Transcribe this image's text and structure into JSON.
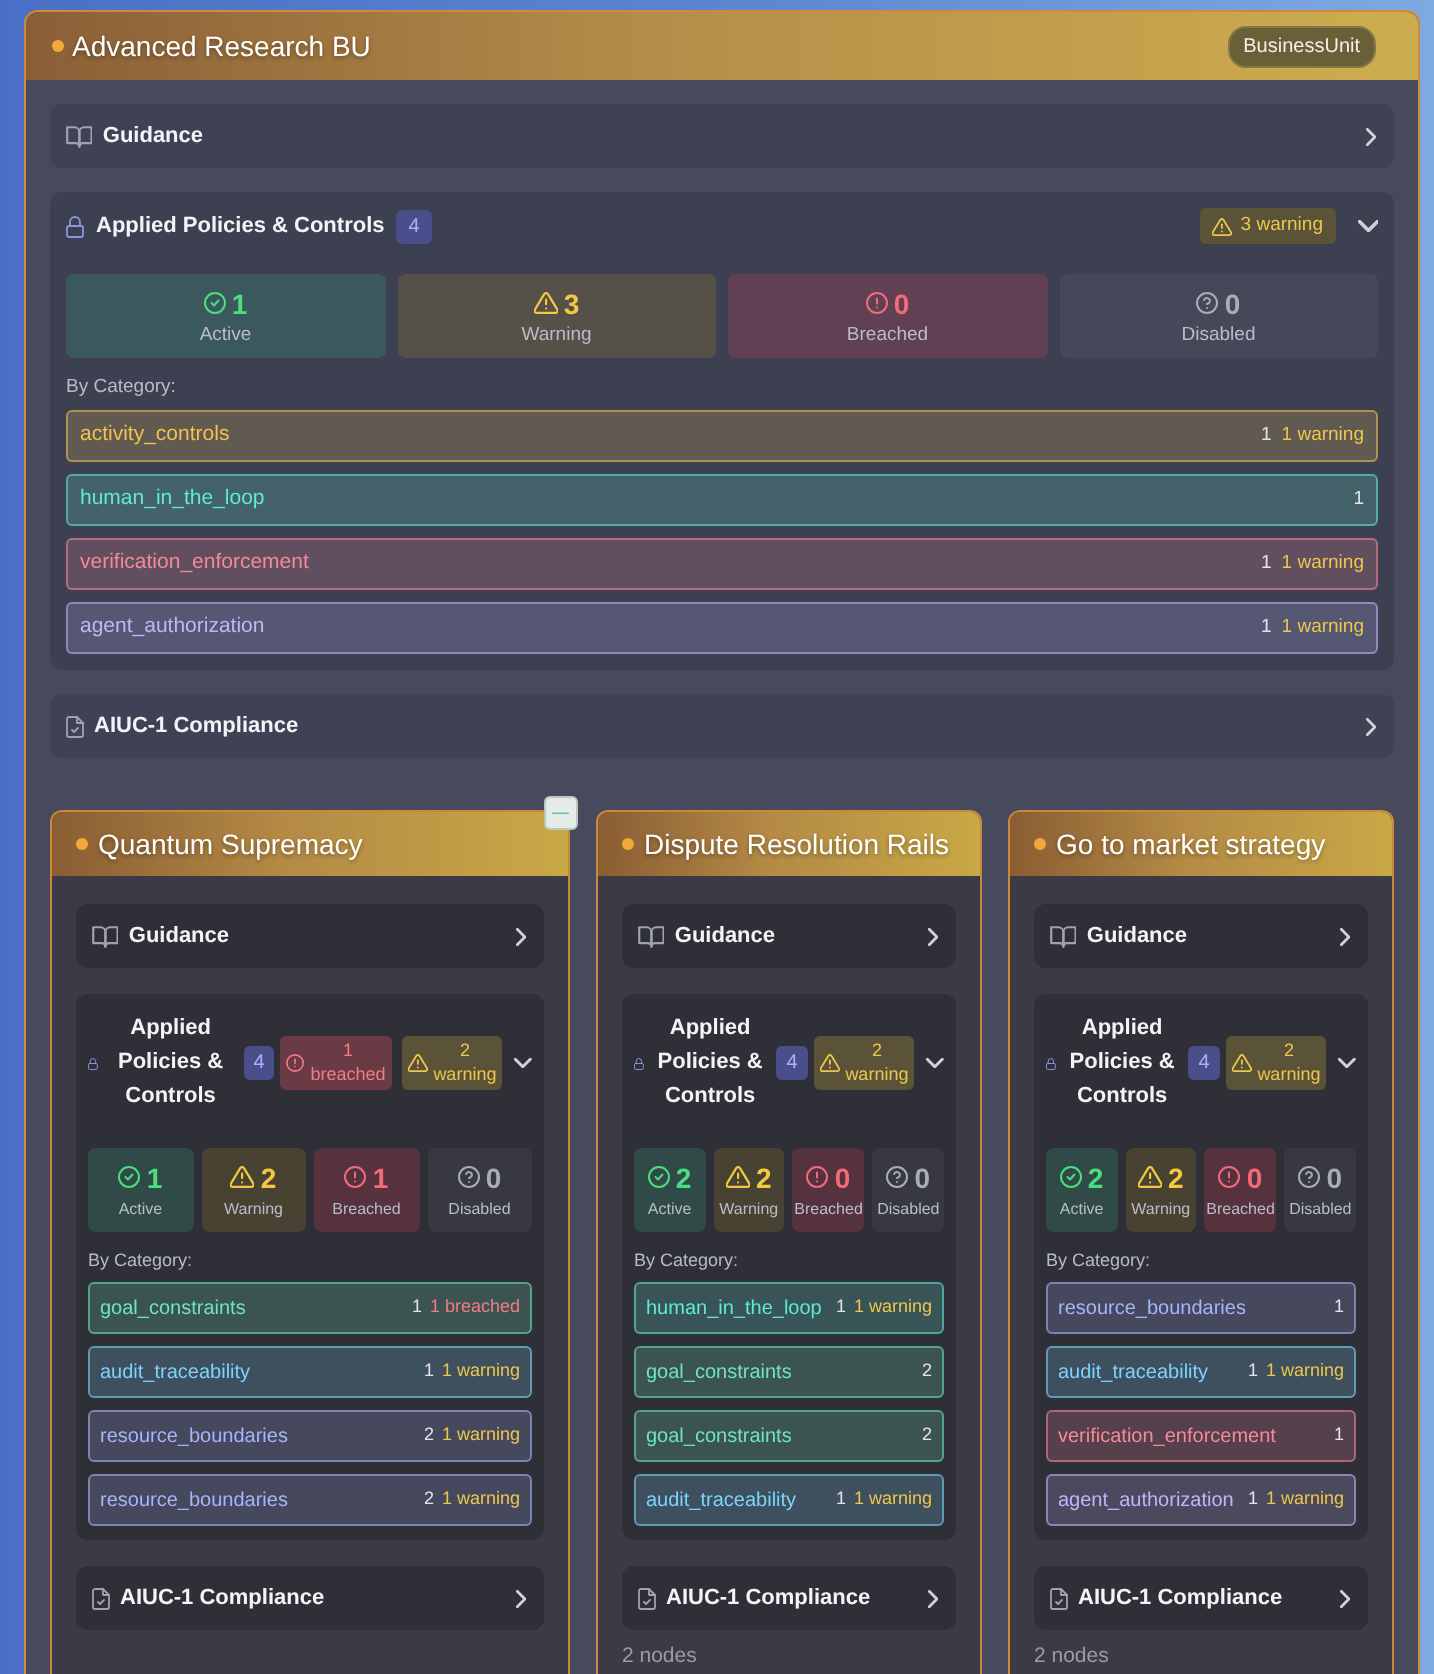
{
  "unit": {
    "title": "Advanced Research BU",
    "badge": "BusinessUnit",
    "sections": [
      {
        "kind": "guidance",
        "title": "Guidance",
        "expanded": false
      },
      {
        "kind": "policies",
        "title": "Applied Policies & Controls",
        "count": "4",
        "expanded": true,
        "alerts": [
          {
            "kind": "warning",
            "text": "3 warning"
          }
        ],
        "stats": [
          {
            "kind": "active",
            "value": "1",
            "label": "Active"
          },
          {
            "kind": "warning",
            "value": "3",
            "label": "Warning"
          },
          {
            "kind": "breached",
            "value": "0",
            "label": "Breached"
          },
          {
            "kind": "disabled",
            "value": "0",
            "label": "Disabled"
          }
        ],
        "category_heading": "By Category:",
        "categories": [
          {
            "name": "activity_controls",
            "color": "#f2c14e",
            "count": "1",
            "status": {
              "kind": "warning",
              "text": "1 warning"
            }
          },
          {
            "name": "human_in_the_loop",
            "color": "#5eead4",
            "count": "1"
          },
          {
            "name": "verification_enforcement",
            "color": "#f4899a",
            "count": "1",
            "status": {
              "kind": "warning",
              "text": "1 warning"
            }
          },
          {
            "name": "agent_authorization",
            "color": "#c0b4fa",
            "count": "1",
            "status": {
              "kind": "warning",
              "text": "1 warning"
            }
          }
        ]
      },
      {
        "kind": "compliance",
        "title": "AIUC-1 Compliance",
        "expanded": false
      }
    ]
  },
  "children_toggle": {
    "expanded": true
  },
  "children": [
    {
      "title": "Quantum Supremacy",
      "sections": [
        {
          "kind": "guidance",
          "title": "Guidance",
          "expanded": false
        },
        {
          "kind": "policies",
          "title": "Applied Policies & Controls",
          "count": "4",
          "expanded": true,
          "alerts": [
            {
              "kind": "breached",
              "text": "1 breached"
            },
            {
              "kind": "warning",
              "text": "2 warning"
            }
          ],
          "stats": [
            {
              "kind": "active",
              "value": "1",
              "label": "Active"
            },
            {
              "kind": "warning",
              "value": "2",
              "label": "Warning"
            },
            {
              "kind": "breached",
              "value": "1",
              "label": "Breached"
            },
            {
              "kind": "disabled",
              "value": "0",
              "label": "Disabled"
            }
          ],
          "category_heading": "By Category:",
          "categories": [
            {
              "name": "goal_constraints",
              "color": "#6ee7b7",
              "count": "1",
              "status": {
                "kind": "breached",
                "text": "1 breached"
              }
            },
            {
              "name": "audit_traceability",
              "color": "#7dd3fc",
              "count": "1",
              "status": {
                "kind": "warning",
                "text": "1 warning"
              }
            },
            {
              "name": "resource_boundaries",
              "color": "#a5b4fc",
              "count": "2",
              "status": {
                "kind": "warning",
                "text": "1 warning"
              }
            },
            {
              "name": "resource_boundaries",
              "color": "#a5b4fc",
              "count": "2",
              "status": {
                "kind": "warning",
                "text": "1 warning"
              }
            }
          ]
        },
        {
          "kind": "compliance",
          "title": "AIUC-1 Compliance",
          "expanded": false
        }
      ]
    },
    {
      "title": "Dispute Resolution Rails",
      "sections": [
        {
          "kind": "guidance",
          "title": "Guidance",
          "expanded": false
        },
        {
          "kind": "policies",
          "title": "Applied Policies & Controls",
          "count": "4",
          "expanded": true,
          "alerts": [
            {
              "kind": "warning",
              "text": "2 warning"
            }
          ],
          "stats": [
            {
              "kind": "active",
              "value": "2",
              "label": "Active"
            },
            {
              "kind": "warning",
              "value": "2",
              "label": "Warning"
            },
            {
              "kind": "breached",
              "value": "0",
              "label": "Breached"
            },
            {
              "kind": "disabled",
              "value": "0",
              "label": "Disabled"
            }
          ],
          "category_heading": "By Category:",
          "categories": [
            {
              "name": "human_in_the_loop",
              "color": "#5eead4",
              "count": "1",
              "status": {
                "kind": "warning",
                "text": "1 warning"
              }
            },
            {
              "name": "goal_constraints",
              "color": "#6ee7b7",
              "count": "2"
            },
            {
              "name": "goal_constraints",
              "color": "#6ee7b7",
              "count": "2"
            },
            {
              "name": "audit_traceability",
              "color": "#7dd3fc",
              "count": "1",
              "status": {
                "kind": "warning",
                "text": "1 warning"
              }
            }
          ]
        },
        {
          "kind": "compliance",
          "title": "AIUC-1 Compliance",
          "expanded": false
        }
      ],
      "footer": "2 nodes"
    },
    {
      "title": "Go to market strategy",
      "sections": [
        {
          "kind": "guidance",
          "title": "Guidance",
          "expanded": false
        },
        {
          "kind": "policies",
          "title": "Applied Policies & Controls",
          "count": "4",
          "expanded": true,
          "alerts": [
            {
              "kind": "warning",
              "text": "2 warning"
            }
          ],
          "stats": [
            {
              "kind": "active",
              "value": "2",
              "label": "Active"
            },
            {
              "kind": "warning",
              "value": "2",
              "label": "Warning"
            },
            {
              "kind": "breached",
              "value": "0",
              "label": "Breached"
            },
            {
              "kind": "disabled",
              "value": "0",
              "label": "Disabled"
            }
          ],
          "category_heading": "By Category:",
          "categories": [
            {
              "name": "resource_boundaries",
              "color": "#a5b4fc",
              "count": "1"
            },
            {
              "name": "audit_traceability",
              "color": "#7dd3fc",
              "count": "1",
              "status": {
                "kind": "warning",
                "text": "1 warning"
              }
            },
            {
              "name": "verification_enforcement",
              "color": "#f4899a",
              "count": "1"
            },
            {
              "name": "agent_authorization",
              "color": "#c0b4fa",
              "count": "1",
              "status": {
                "kind": "warning",
                "text": "1 warning"
              }
            }
          ]
        },
        {
          "kind": "compliance",
          "title": "AIUC-1 Compliance",
          "expanded": false
        }
      ],
      "footer": "2 nodes"
    }
  ]
}
